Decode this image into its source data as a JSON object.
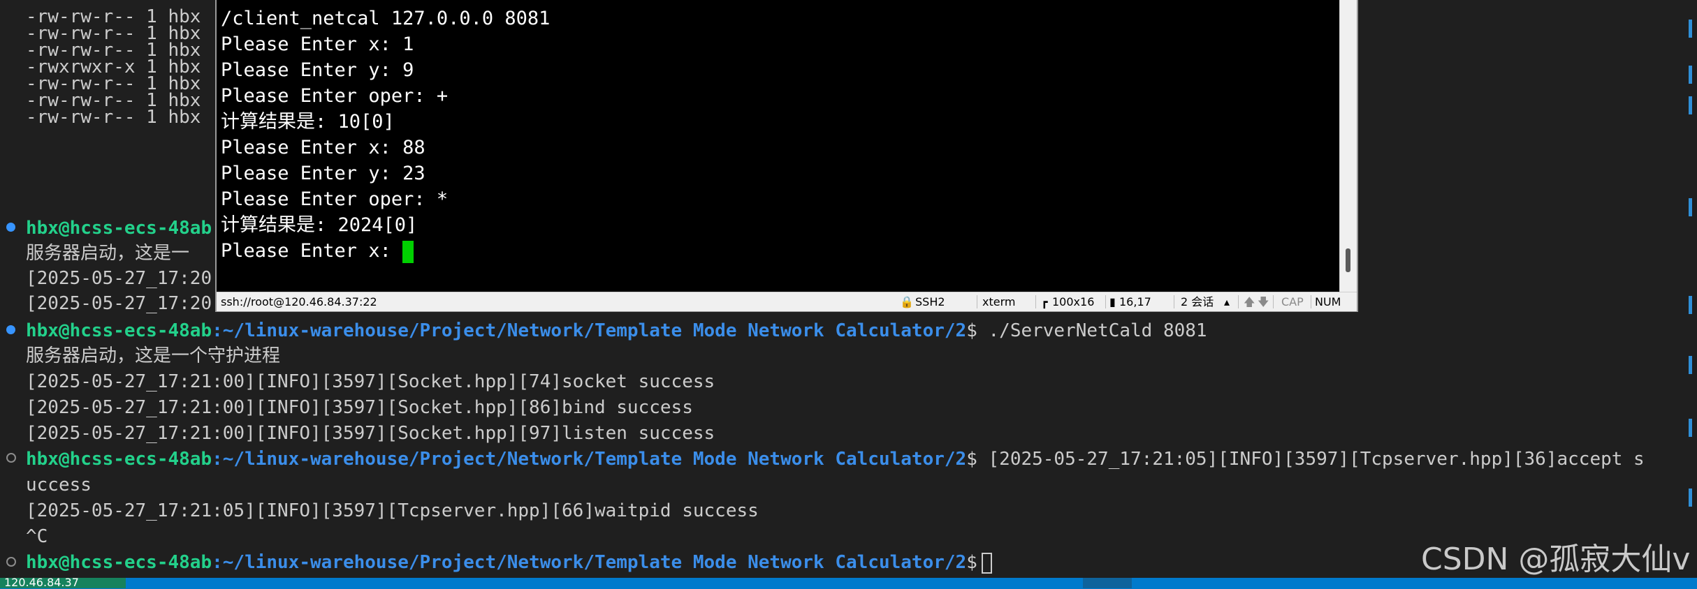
{
  "background_terminal": {
    "listing": [
      "-rw-rw-r-- 1 hbx",
      "-rw-rw-r-- 1 hbx",
      "-rw-rw-r-- 1 hbx",
      "-rwxrwxr-x 1 hbx",
      "-rw-rw-r-- 1 hbx",
      "-rw-rw-r-- 1 hbx",
      "-rw-rw-r-- 1 hbx"
    ],
    "prompt_user": "hbx@hcss-ecs-48ab",
    "partial_prompt_user": "hbx@hcss-ecs-48ab",
    "partial_daemon": "服务器启动，这是一",
    "partial_log1": "[2025-05-27_17:20",
    "partial_log2": "[2025-05-27_17:20",
    "prompt_path": ":~/linux-warehouse/Project/Network/Template Mode Network Calculator/2",
    "prompt_symbol": "$",
    "command_server": " ./ServerNetCald 8081",
    "daemon_msg": "服务器启动，这是一个守护进程",
    "log_socket": "[2025-05-27_17:21:00][INFO][3597][Socket.hpp][74]socket success",
    "log_bind": "[2025-05-27_17:21:00][INFO][3597][Socket.hpp][86]bind success",
    "log_listen": "[2025-05-27_17:21:00][INFO][3597][Socket.hpp][97]listen success",
    "log_accept_a": " [2025-05-27_17:21:05][INFO][3597][Tcpserver.hpp][36]accept s",
    "log_accept_b": "uccess",
    "log_waitpid": "[2025-05-27_17:21:05][INFO][3597][Tcpserver.hpp][66]waitpid success",
    "interrupt": "^C"
  },
  "ssh_terminal": {
    "lines": [
      "/client_netcal 127.0.0.0 8081",
      "Please Enter x: 1",
      "Please Enter y: 9",
      "Please Enter oper: +",
      "计算结果是: 10[0]",
      "Please Enter x: 88",
      "Please Enter y: 23",
      "Please Enter oper: *",
      "计算结果是: 2024[0]"
    ],
    "current_prompt": "Please Enter x: ",
    "status": {
      "connection": "ssh://root@120.46.84.37:22",
      "protocol": "SSH2",
      "terminal_type": "xterm",
      "size": "100x16",
      "cursor_pos": "16,17",
      "sessions": "2 会话",
      "caps": "CAP",
      "num": "NUM"
    }
  },
  "status_bar": {
    "remote": "120.46.84.37"
  },
  "watermark": "CSDN @孤寂大仙v",
  "colors": {
    "terminal_bg": "#1f1f1f",
    "prompt_user": "#23d18b",
    "prompt_path": "#3b8eea",
    "cursor": "#00d000",
    "status_bar": "#007acc"
  }
}
